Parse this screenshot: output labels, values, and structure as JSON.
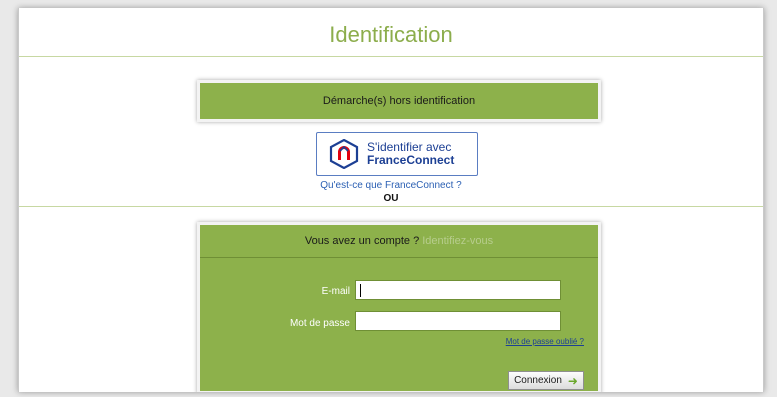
{
  "page": {
    "title": "Identification"
  },
  "no_login": {
    "label": "Démarche(s) hors identification"
  },
  "franceconnect": {
    "button_line1": "S'identifier avec",
    "button_line2": "FranceConnect",
    "info_link": "Qu'est-ce que FranceConnect ?",
    "separator": "OU",
    "logo_colors": {
      "blue": "#1c3f94",
      "red": "#e1000f"
    }
  },
  "login": {
    "heading": "Vous avez un compte ?",
    "heading_hint": "Identifiez-vous",
    "email_label": "E-mail",
    "email_value": "",
    "password_label": "Mot de passe",
    "password_value": "",
    "forgot_link": "Mot de passe oublié ?",
    "submit_label": "Connexion",
    "submit_icon": "arrow-right-icon"
  },
  "colors": {
    "accent_green": "#8db14b",
    "title_green": "#8cad4c"
  }
}
